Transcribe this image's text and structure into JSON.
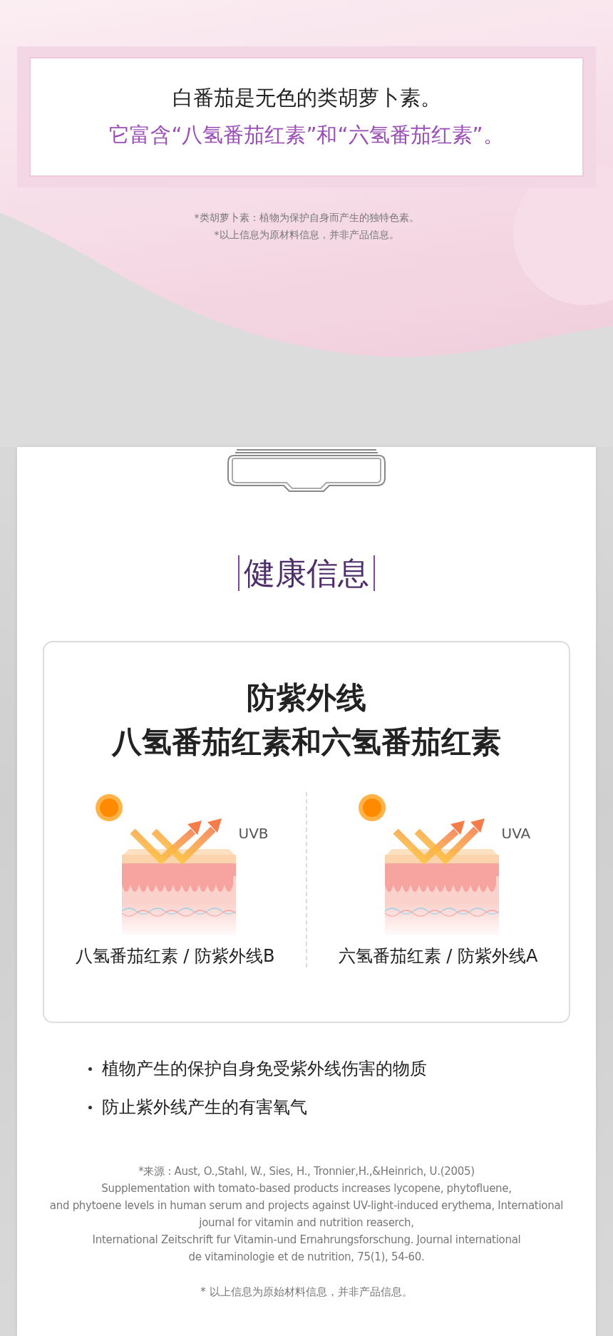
{
  "notice": {
    "line_1": "白番茄是无色的类胡萝卜素。",
    "line_2": "它富含“八氢番茄红素”和“六氢番茄红素”。"
  },
  "footnotes": [
    "*类胡萝卜素：植物为保护自身而产生的独特色素。",
    "*以上信息为原材料信息，并非产品信息。"
  ],
  "section": {
    "title": "健康信息",
    "panel": {
      "heading": [
        "防紫外线",
        "八氢番茄红素和六氢番茄红素"
      ],
      "items": [
        {
          "ray": "UVB",
          "caption": "八氢番茄红素 / 防紫外线B"
        },
        {
          "ray": "UVA",
          "caption": "六氢番茄红素 / 防紫外线A"
        }
      ]
    },
    "bullets": [
      "植物产生的保护自身免受紫外线伤害的物质",
      "防止紫外线产生的有害氧气"
    ],
    "citation": "*来源 : Aust, O.,Stahl, W., Sies, H., Tronnier,H.,&Heinrich, U.(2005)\nSupplementation with tomato-based products increases lycopene, phytofluene,\nand phytoene levels in human serum and projects against UV-light-induced erythema, International\njournal for vitamin and nutrition reaserch,\nInternational Zeitschrift fur Vitamin-und Ernahrungsforschung. Journal international\nde vitaminologie et de nutrition, 75(1), 54-60.",
    "note": "* 以上信息为原始材料信息，并非产品信息。"
  }
}
